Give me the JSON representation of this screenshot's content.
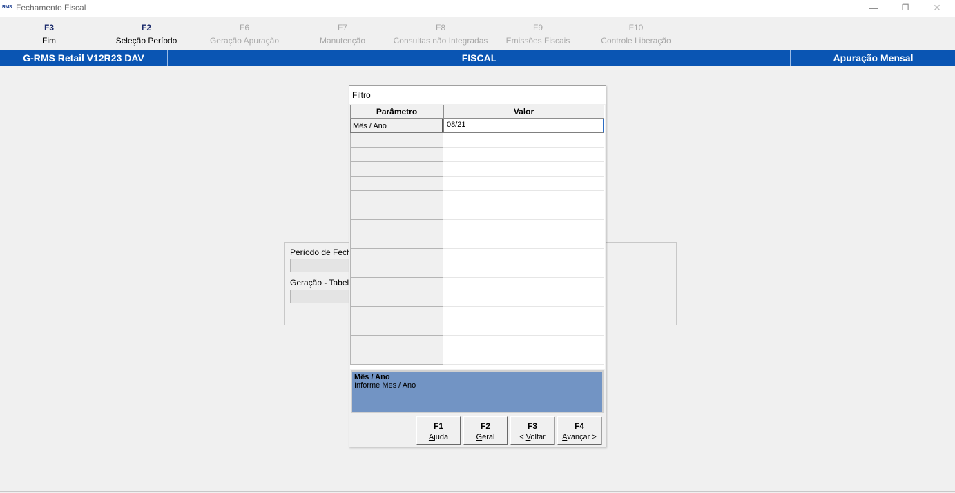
{
  "window": {
    "title": "Fechamento Fiscal",
    "logo_text": "RMS",
    "controls": {
      "minimize": "—",
      "restore": "❐",
      "close": "✕"
    }
  },
  "toolbar": [
    {
      "key": "F3",
      "label": "Fim",
      "enabled": true
    },
    {
      "key": "F2",
      "label": "Seleção Período",
      "enabled": true
    },
    {
      "key": "F6",
      "label": "Geração Apuração",
      "enabled": false
    },
    {
      "key": "F7",
      "label": "Manutenção",
      "enabled": false
    },
    {
      "key": "F8",
      "label": "Consultas não Integradas",
      "enabled": false
    },
    {
      "key": "F9",
      "label": "Emissões Fiscais",
      "enabled": false
    },
    {
      "key": "F10",
      "label": "Controle Liberação",
      "enabled": false
    }
  ],
  "header": {
    "left": "G-RMS Retail V12R23 DAV",
    "center": "FISCAL",
    "right": "Apuração Mensal"
  },
  "background_panel": {
    "periodo_label": "Período de Fecha",
    "geracao_label": "Geração - Tabela"
  },
  "dialog": {
    "title": "Filtro",
    "columns": {
      "param": "Parâmetro",
      "valor": "Valor"
    },
    "rows": [
      {
        "param": "Mês / Ano",
        "valor": "08/21"
      },
      {
        "param": "",
        "valor": ""
      },
      {
        "param": "",
        "valor": ""
      },
      {
        "param": "",
        "valor": ""
      },
      {
        "param": "",
        "valor": ""
      },
      {
        "param": "",
        "valor": ""
      },
      {
        "param": "",
        "valor": ""
      },
      {
        "param": "",
        "valor": ""
      },
      {
        "param": "",
        "valor": ""
      },
      {
        "param": "",
        "valor": ""
      },
      {
        "param": "",
        "valor": ""
      },
      {
        "param": "",
        "valor": ""
      },
      {
        "param": "",
        "valor": ""
      },
      {
        "param": "",
        "valor": ""
      },
      {
        "param": "",
        "valor": ""
      },
      {
        "param": "",
        "valor": ""
      },
      {
        "param": "",
        "valor": ""
      }
    ],
    "help": {
      "title": "Mês / Ano",
      "text": "Informe Mes / Ano"
    },
    "buttons": {
      "f1": {
        "key": "F1",
        "label_accel": "A",
        "label_rest": "juda"
      },
      "f2": {
        "key": "F2",
        "label_accel": "G",
        "label_rest": "eral"
      },
      "f3": {
        "key": "F3",
        "label_pre": "< ",
        "label_accel": "V",
        "label_rest": "oltar"
      },
      "f4": {
        "key": "F4",
        "label_accel": "A",
        "label_rest": "vançar >"
      }
    }
  },
  "colors": {
    "header_blue": "#0a55b3",
    "help_blue": "#7294c4",
    "active_key": "#1a2a6b",
    "disabled_text": "#a8a8a8"
  }
}
